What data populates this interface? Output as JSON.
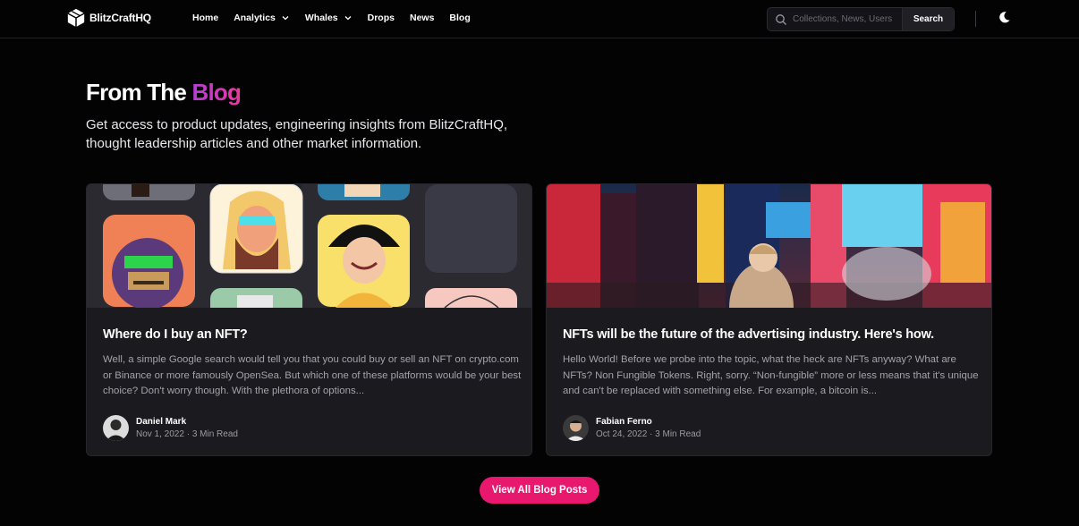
{
  "nav": {
    "brand": "BlitzCraftHQ",
    "links": [
      {
        "label": "Home"
      },
      {
        "label": "Analytics"
      },
      {
        "label": "Whales"
      },
      {
        "label": "Drops"
      },
      {
        "label": "News"
      },
      {
        "label": "Blog"
      }
    ],
    "search": {
      "placeholder": "Collections, News, Users",
      "button_label": "Search"
    }
  },
  "hero": {
    "title_prefix": "From The ",
    "title_accent": "Blog",
    "subtitle": "Get access to product updates, engineering insights from BlitzCraftHQ, thought leadership articles and other market information."
  },
  "posts": [
    {
      "title": "Where do I buy an NFT?",
      "excerpt": "Well, a simple Google search would tell you that you could buy or sell an NFT on crypto.com or Binance or more famously OpenSea. But which one of these platforms would be your best choice? Don't worry though. With the plethora of options...",
      "author": "Daniel Mark",
      "meta": "Nov 1, 2022 · 3 Min Read"
    },
    {
      "title": "NFTs will be the future of the advertising industry. Here's how.",
      "excerpt": "Hello World! Before we probe into the topic, what the heck are NFTs anyway? What are NFTs? Non Fungible Tokens. Right, sorry. “Non-fungible” more or less means that it's unique and can't be replaced with something else. For example, a bitcoin is...",
      "author": "Fabian Ferno",
      "meta": "Oct 24, 2022 · 3 Min Read"
    }
  ],
  "cta": {
    "label": "View All Blog Posts"
  },
  "colors": {
    "background": "#030304",
    "accent_pink": "#e8186f",
    "title_gradient_start": "#b63cd9",
    "card_bg": "#1b1b1f"
  },
  "icons": [
    "logo-cube-icon",
    "chevron-down-icon",
    "search-icon",
    "moon-icon"
  ]
}
